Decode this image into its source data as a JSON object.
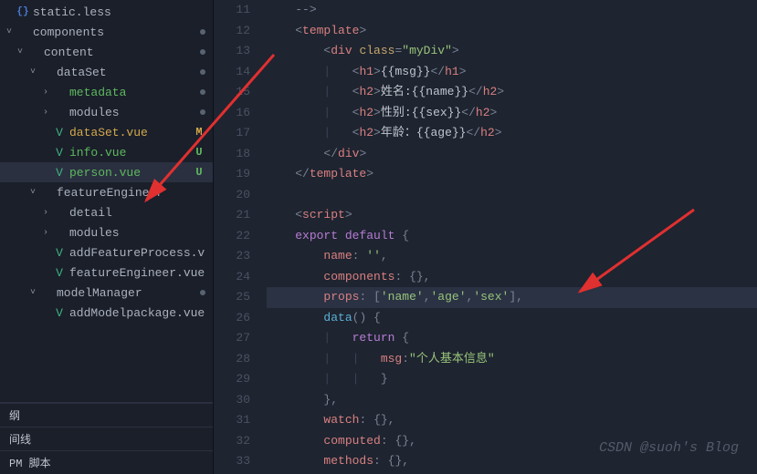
{
  "sidebar": {
    "items": [
      {
        "indent": 0,
        "chev": "",
        "icon": "{}",
        "iconClass": "less-icon",
        "label": "static.less",
        "status": "",
        "dot": false,
        "green": false
      },
      {
        "indent": 0,
        "chev": "˅",
        "icon": "",
        "iconClass": "",
        "label": "components",
        "status": "",
        "dot": true,
        "green": false
      },
      {
        "indent": 1,
        "chev": "˅",
        "icon": "",
        "iconClass": "",
        "label": "content",
        "status": "",
        "dot": true,
        "green": false
      },
      {
        "indent": 2,
        "chev": "˅",
        "icon": "",
        "iconClass": "",
        "label": "dataSet",
        "status": "",
        "dot": true,
        "green": false
      },
      {
        "indent": 3,
        "chev": "›",
        "icon": "",
        "iconClass": "",
        "label": "metadata",
        "status": "",
        "dot": true,
        "green": true
      },
      {
        "indent": 3,
        "chev": "›",
        "icon": "",
        "iconClass": "",
        "label": "modules",
        "status": "",
        "dot": true,
        "green": false
      },
      {
        "indent": 3,
        "chev": "",
        "icon": "V",
        "iconClass": "vue-icon",
        "label": "dataSet.vue",
        "status": "M",
        "dot": false,
        "green": false,
        "statusClass": "status-M"
      },
      {
        "indent": 3,
        "chev": "",
        "icon": "V",
        "iconClass": "vue-icon",
        "label": "info.vue",
        "status": "U",
        "dot": false,
        "green": true,
        "statusClass": "status-U"
      },
      {
        "indent": 3,
        "chev": "",
        "icon": "V",
        "iconClass": "vue-icon",
        "label": "person.vue",
        "status": "U",
        "dot": false,
        "green": true,
        "statusClass": "status-U",
        "selected": true
      },
      {
        "indent": 2,
        "chev": "˅",
        "icon": "",
        "iconClass": "",
        "label": "featureEngineer",
        "status": "",
        "dot": false,
        "green": false
      },
      {
        "indent": 3,
        "chev": "›",
        "icon": "",
        "iconClass": "",
        "label": "detail",
        "status": "",
        "dot": false,
        "green": false
      },
      {
        "indent": 3,
        "chev": "›",
        "icon": "",
        "iconClass": "",
        "label": "modules",
        "status": "",
        "dot": false,
        "green": false
      },
      {
        "indent": 3,
        "chev": "",
        "icon": "V",
        "iconClass": "vue-icon",
        "label": "addFeatureProcess.vue",
        "status": "",
        "dot": false,
        "green": false
      },
      {
        "indent": 3,
        "chev": "",
        "icon": "V",
        "iconClass": "vue-icon",
        "label": "featureEngineer.vue",
        "status": "",
        "dot": false,
        "green": false
      },
      {
        "indent": 2,
        "chev": "˅",
        "icon": "",
        "iconClass": "",
        "label": "modelManager",
        "status": "",
        "dot": true,
        "green": false
      },
      {
        "indent": 3,
        "chev": "",
        "icon": "V",
        "iconClass": "vue-icon",
        "label": "addModelpackage.vue",
        "status": "",
        "dot": false,
        "green": false
      }
    ],
    "bottom": [
      "纲",
      "间线",
      "PM 脚本"
    ]
  },
  "editor": {
    "startLine": 11,
    "lines": [
      {
        "n": 11,
        "html": "<span class='guide'>    </span><span class='c-punc'>--&gt;</span>"
      },
      {
        "n": 12,
        "html": "<span class='guide'>    </span><span class='c-punc'>&lt;</span><span class='c-tag'>template</span><span class='c-punc'>&gt;</span>"
      },
      {
        "n": 13,
        "html": "<span class='guide'>        </span><span class='c-punc'>&lt;</span><span class='c-tag'>div</span> <span class='c-attr'>class</span><span class='c-punc'>=</span><span class='c-str'>\"myDiv\"</span><span class='c-punc'>&gt;</span>"
      },
      {
        "n": 14,
        "html": "<span class='guide'>        |   </span><span class='c-punc'>&lt;</span><span class='c-tag'>h1</span><span class='c-punc'>&gt;</span><span class='c-txt'>{{msg}}</span><span class='c-punc'>&lt;/</span><span class='c-tag'>h1</span><span class='c-punc'>&gt;</span>"
      },
      {
        "n": 15,
        "html": "<span class='guide'>        |   </span><span class='c-punc'>&lt;</span><span class='c-tag'>h2</span><span class='c-punc'>&gt;</span><span class='c-txt'>姓名:{{name}}</span><span class='c-punc'>&lt;/</span><span class='c-tag'>h2</span><span class='c-punc'>&gt;</span>"
      },
      {
        "n": 16,
        "html": "<span class='guide'>        |   </span><span class='c-punc'>&lt;</span><span class='c-tag'>h2</span><span class='c-punc'>&gt;</span><span class='c-txt'>性别:{{sex}}</span><span class='c-punc'>&lt;/</span><span class='c-tag'>h2</span><span class='c-punc'>&gt;</span>"
      },
      {
        "n": 17,
        "html": "<span class='guide'>        |   </span><span class='c-punc'>&lt;</span><span class='c-tag'>h2</span><span class='c-punc'>&gt;</span><span class='c-txt'>年龄：{{age}}</span><span class='c-punc'>&lt;/</span><span class='c-tag'>h2</span><span class='c-punc'>&gt;</span>"
      },
      {
        "n": 18,
        "html": "<span class='guide'>        </span><span class='c-punc'>&lt;/</span><span class='c-tag'>div</span><span class='c-punc'>&gt;</span>"
      },
      {
        "n": 19,
        "html": "<span class='guide'>    </span><span class='c-punc'>&lt;/</span><span class='c-tag'>template</span><span class='c-punc'>&gt;</span>"
      },
      {
        "n": 20,
        "html": ""
      },
      {
        "n": 21,
        "html": "<span class='guide'>    </span><span class='c-punc'>&lt;</span><span class='c-tag'>script</span><span class='c-punc'>&gt;</span>"
      },
      {
        "n": 22,
        "html": "<span class='guide'>    </span><span class='c-kw'>export</span> <span class='c-kw'>default</span> <span class='c-punc'>{</span>"
      },
      {
        "n": 23,
        "html": "<span class='guide'>        </span><span class='c-prop'>name</span><span class='c-punc'>:</span> <span class='c-str'>''</span><span class='c-punc'>,</span>"
      },
      {
        "n": 24,
        "html": "<span class='guide'>        </span><span class='c-prop'>components</span><span class='c-punc'>:</span> <span class='c-punc'>{},</span>"
      },
      {
        "n": 25,
        "hl": true,
        "html": "<span class='guide'>        </span><span class='c-prop'>props</span><span class='c-punc'>:</span> <span class='c-punc'>[</span><span class='c-str'>'name'</span><span class='c-punc'>,</span><span class='c-str'>'age'</span><span class='c-punc'>,</span><span class='c-str'>'sex'</span><span class='c-punc'>],</span>"
      },
      {
        "n": 26,
        "html": "<span class='guide'>        </span><span class='c-fn'>data</span><span class='c-punc'>() {</span>"
      },
      {
        "n": 27,
        "html": "<span class='guide'>        |   </span><span class='c-kw2'>return</span> <span class='c-punc'>{</span>"
      },
      {
        "n": 28,
        "html": "<span class='guide'>        |   |   </span><span class='c-prop'>msg</span><span class='c-punc'>:</span><span class='c-str'>\"个人基本信息\"</span>"
      },
      {
        "n": 29,
        "html": "<span class='guide'>        |   |   </span><span class='c-punc'>}</span>"
      },
      {
        "n": 30,
        "html": "<span class='guide'>        </span><span class='c-punc'>},</span>"
      },
      {
        "n": 31,
        "html": "<span class='guide'>        </span><span class='c-prop'>watch</span><span class='c-punc'>:</span> <span class='c-punc'>{},</span>"
      },
      {
        "n": 32,
        "html": "<span class='guide'>        </span><span class='c-prop'>computed</span><span class='c-punc'>:</span> <span class='c-punc'>{},</span>"
      },
      {
        "n": 33,
        "html": "<span class='guide'>        </span><span class='c-prop'>methods</span><span class='c-punc'>:</span> <span class='c-punc'>{},</span>"
      }
    ]
  },
  "watermark": "CSDN @suoh's Blog"
}
